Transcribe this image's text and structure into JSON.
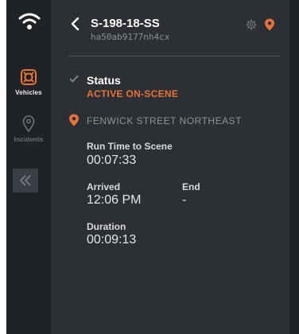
{
  "nav": {
    "items": [
      {
        "label": "Vehicles",
        "icon": "ambulance-wheel-icon",
        "active": true
      },
      {
        "label": "Incidents",
        "icon": "location-pin-icon",
        "active": false
      }
    ],
    "collapse_icon": "double-chevron-left-icon"
  },
  "header": {
    "title": "S-198-18-SS",
    "subtitle": "ha50ab9177nh4cx"
  },
  "status": {
    "label": "Status",
    "value": "ACTIVE ON-SCENE"
  },
  "location": "FENWICK STREET NORTHEAST",
  "fields": {
    "run_time_label": "Run Time to Scene",
    "run_time_value": "00:07:33",
    "arrived_label": "Arrived",
    "arrived_value": "12:06 PM",
    "end_label": "End",
    "end_value": "-",
    "duration_label": "Duration",
    "duration_value": "00:09:13"
  },
  "colors": {
    "accent": "#e8733a",
    "rail_bg": "#1f2226",
    "panel_bg": "#2c2f33"
  }
}
